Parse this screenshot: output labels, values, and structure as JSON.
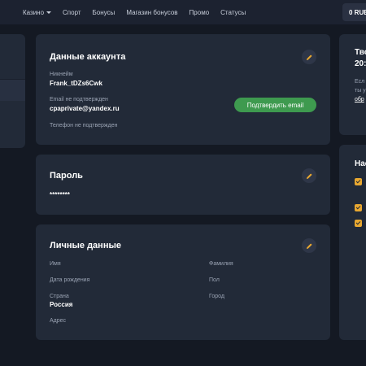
{
  "nav": {
    "items": [
      "Казино",
      "Спорт",
      "Бонусы",
      "Магазин бонусов",
      "Промо",
      "Статусы"
    ],
    "balance": "0 RUB"
  },
  "account": {
    "title": "Данные аккаунта",
    "nickname_label": "Никнейм",
    "nickname": "Frank_tDZs6Cwk",
    "email_label": "Email не подтвержден",
    "email": "cpaprivate@yandex.ru",
    "confirm_email": "Подтвердить email",
    "phone_label": "Телефон не подтвержден"
  },
  "password": {
    "title": "Пароль",
    "value": "********"
  },
  "personal": {
    "title": "Личные данные",
    "first_name_label": "Имя",
    "last_name_label": "Фамилия",
    "birthdate_label": "Дата рождения",
    "gender_label": "Пол",
    "country_label": "Страна",
    "country": "Россия",
    "city_label": "Город",
    "address_label": "Адрес"
  },
  "right_panel": {
    "card1_title_line1": "Тво",
    "card1_title_line2": "20:",
    "card1_text1": "Есл",
    "card1_text2": "ты у",
    "card1_link": "обр",
    "card2_title": "Нас"
  },
  "colors": {
    "background": "#141923",
    "card": "#222a38",
    "accent_green": "#3e9a4f",
    "accent_orange": "#e9a830"
  }
}
